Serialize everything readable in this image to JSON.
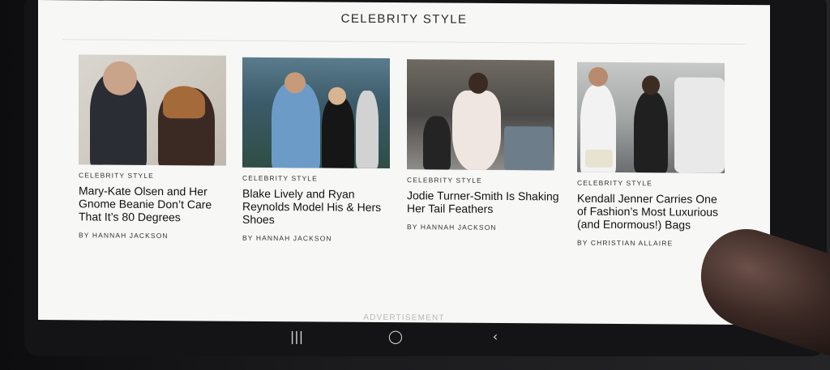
{
  "section": {
    "title": "CELEBRITY STYLE"
  },
  "articles": [
    {
      "kicker": "CELEBRITY STYLE",
      "headline": "Mary-Kate Olsen and Her Gnome Beanie Don’t Care That It’s 80 Degrees",
      "byline": "BY HANNAH JACKSON"
    },
    {
      "kicker": "CELEBRITY STYLE",
      "headline": "Blake Lively and Ryan Reynolds Model His & Hers Shoes",
      "byline": "BY HANNAH JACKSON"
    },
    {
      "kicker": "CELEBRITY STYLE",
      "headline": "Jodie Turner-Smith Is Shaking Her Tail Feathers",
      "byline": "BY HANNAH JACKSON"
    },
    {
      "kicker": "CELEBRITY STYLE",
      "headline": "Kendall Jenner Carries One of Fashion’s Most Luxurious (and Enormous!) Bags",
      "byline": "BY CHRISTIAN ALLAIRE"
    }
  ],
  "ad": {
    "label": "ADVERTISEMENT"
  },
  "system_nav": {
    "recents_icon": "recents-icon",
    "home_icon": "home-icon",
    "back_icon": "back-icon"
  },
  "colors": {
    "screen_bg": "#f7f7f5",
    "text": "#111111",
    "bezel": "#141416"
  }
}
